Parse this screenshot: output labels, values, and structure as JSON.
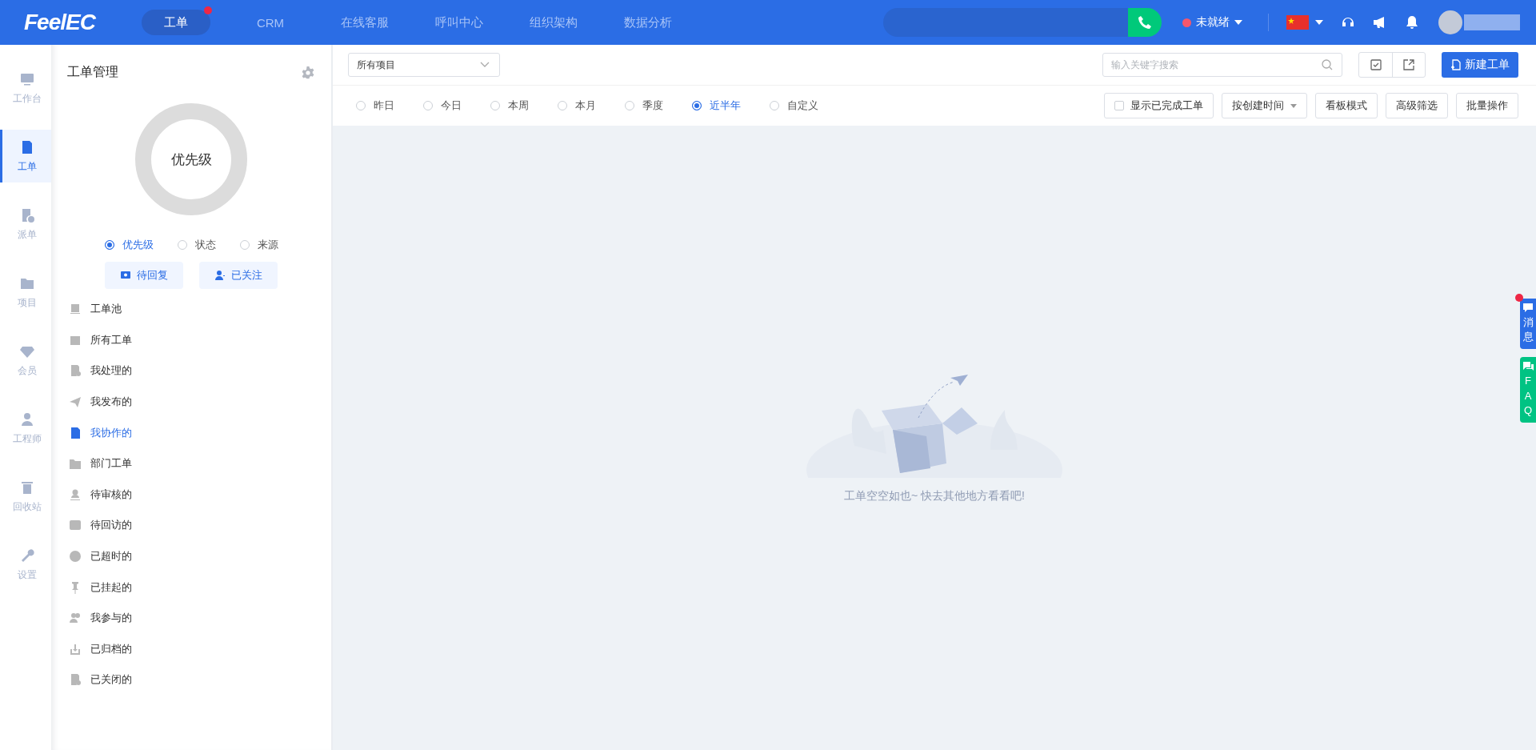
{
  "top_nav": {
    "logo": "FeelEC",
    "tabs": [
      {
        "label": "工单",
        "selected": true,
        "notification_dot": true
      },
      {
        "label": "CRM",
        "selected": false,
        "notification_dot": false
      },
      {
        "label": "在线客服",
        "selected": false,
        "notification_dot": false
      },
      {
        "label": "呼叫中心",
        "selected": false,
        "notification_dot": false
      },
      {
        "label": "组织架构",
        "selected": false,
        "notification_dot": false
      },
      {
        "label": "数据分析",
        "selected": false,
        "notification_dot": false
      }
    ],
    "agent_status": {
      "label": "未就绪",
      "color": "#f5576c"
    }
  },
  "rail": {
    "items": [
      {
        "label": "工作台",
        "selected": false
      },
      {
        "label": "工单",
        "selected": true
      },
      {
        "label": "派单",
        "selected": false
      },
      {
        "label": "项目",
        "selected": false
      },
      {
        "label": "会员",
        "selected": false
      },
      {
        "label": "工程师",
        "selected": false
      },
      {
        "label": "回收站",
        "selected": false
      },
      {
        "label": "设置",
        "selected": false
      }
    ]
  },
  "panel": {
    "title": "工单管理",
    "donut_label": "优先级",
    "group_by": [
      {
        "label": "优先级",
        "selected": true
      },
      {
        "label": "状态",
        "selected": false
      },
      {
        "label": "来源",
        "selected": false
      }
    ],
    "quick_buttons": [
      {
        "label": "待回复"
      },
      {
        "label": "已关注"
      }
    ],
    "items": [
      {
        "label": "工单池",
        "selected": false
      },
      {
        "label": "所有工单",
        "selected": false
      },
      {
        "label": "我处理的",
        "selected": false
      },
      {
        "label": "我发布的",
        "selected": false
      },
      {
        "label": "我协作的",
        "selected": true
      },
      {
        "label": "部门工单",
        "selected": false
      },
      {
        "label": "待审核的",
        "selected": false
      },
      {
        "label": "待回访的",
        "selected": false
      },
      {
        "label": "已超时的",
        "selected": false
      },
      {
        "label": "已挂起的",
        "selected": false
      },
      {
        "label": "我参与的",
        "selected": false
      },
      {
        "label": "已归档的",
        "selected": false
      },
      {
        "label": "已关闭的",
        "selected": false
      }
    ]
  },
  "main": {
    "project_select": {
      "value": "所有项目"
    },
    "search": {
      "placeholder": "输入关键字搜索"
    },
    "new_button": "新建工单",
    "date_filters": [
      {
        "label": "昨日",
        "selected": false
      },
      {
        "label": "今日",
        "selected": false
      },
      {
        "label": "本周",
        "selected": false
      },
      {
        "label": "本月",
        "selected": false
      },
      {
        "label": "季度",
        "selected": false
      },
      {
        "label": "近半年",
        "selected": true
      },
      {
        "label": "自定义",
        "selected": false
      }
    ],
    "show_completed": {
      "label": "显示已完成工单",
      "checked": false
    },
    "sort": {
      "label": "按创建时间"
    },
    "buttons": [
      "看板模式",
      "高级筛选",
      "批量操作"
    ],
    "empty_message": "工单空空如也~ 快去其他地方看看吧!"
  },
  "side_tabs": [
    {
      "kind": "messages",
      "label": "消息",
      "notification_dot": true
    },
    {
      "kind": "faq",
      "label": "FAQ",
      "notification_dot": false
    }
  ]
}
